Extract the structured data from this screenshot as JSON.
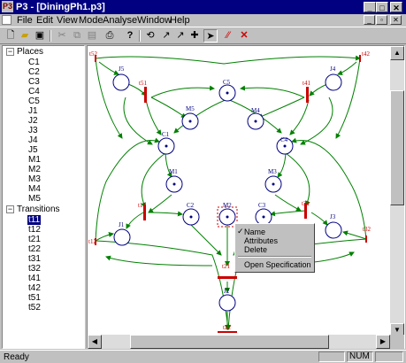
{
  "window": {
    "title": "P3 - [DiningPh1.p3]",
    "app_icon": "P3"
  },
  "menu": [
    "File",
    "Edit",
    "View",
    "Mode",
    "Analyse",
    "Window",
    "Help"
  ],
  "toolbar": {
    "icons": [
      "new-file-icon",
      "open-folder-icon",
      "save-icon",
      "cut-icon",
      "copy-icon",
      "paste-icon",
      "print-icon",
      "help-icon",
      "zoom-icon",
      "edit-arc-icon",
      "arc-icon",
      "add-token-icon",
      "select-pointer-icon",
      "arc-tool-icon",
      "delete-icon"
    ],
    "active": "select-pointer-icon"
  },
  "tree": {
    "places": {
      "label": "Places",
      "items": [
        "C1",
        "C2",
        "C3",
        "C4",
        "C5",
        "J1",
        "J2",
        "J3",
        "J4",
        "J5",
        "M1",
        "M2",
        "M3",
        "M4",
        "M5"
      ]
    },
    "transitions": {
      "label": "Transitions",
      "items": [
        "t11",
        "t12",
        "t21",
        "t22",
        "t31",
        "t32",
        "t41",
        "t42",
        "t51",
        "t52"
      ],
      "selected": "t11"
    }
  },
  "net": {
    "places": [
      {
        "id": "C1",
        "label": "C1"
      },
      {
        "id": "C2",
        "label": "C2"
      },
      {
        "id": "C3",
        "label": "C3"
      },
      {
        "id": "C4",
        "label": "C4"
      },
      {
        "id": "C5",
        "label": "C5"
      },
      {
        "id": "J1",
        "label": "J1"
      },
      {
        "id": "J2",
        "label": "J2"
      },
      {
        "id": "J3",
        "label": "J3"
      },
      {
        "id": "J4",
        "label": "J4"
      },
      {
        "id": "J5",
        "label": "J5"
      },
      {
        "id": "M1",
        "label": "M1"
      },
      {
        "id": "M2",
        "label": "M2"
      },
      {
        "id": "M3",
        "label": "M3"
      },
      {
        "id": "M4",
        "label": "M4"
      },
      {
        "id": "M5",
        "label": "M5"
      }
    ],
    "transitions": [
      "t11",
      "t12",
      "t21",
      "t22",
      "t31",
      "t32",
      "t41",
      "t42",
      "t51",
      "t52"
    ]
  },
  "context_menu": {
    "items": [
      "Name",
      "Attributes",
      "Delete",
      "Open Specification"
    ],
    "checked": "Name"
  },
  "status": {
    "text": "Ready",
    "num": "NUM"
  },
  "colors": {
    "titlebar": "#000080",
    "place": "#000080",
    "arc": "#008000",
    "transition": "#cc0000",
    "label": "#800000"
  }
}
